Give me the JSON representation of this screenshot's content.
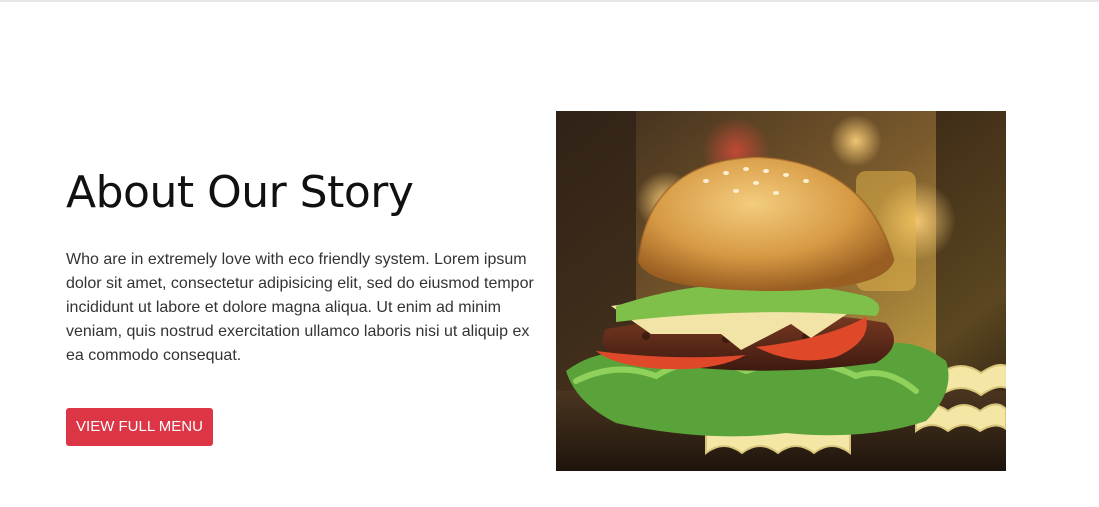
{
  "about": {
    "title": "About Our Story",
    "description": "Who are in extremely love with eco friendly system. Lorem ipsum dolor sit amet, consectetur adipisicing elit, sed do eiusmod tempor incididunt ut labore et dolore magna aliqua. Ut enim ad minim veniam, quis nostrud exercitation ullamco laboris nisi ut aliquip ex ea commodo consequat.",
    "button_label": "VIEW FULL MENU",
    "image_subject": "burger-photo"
  },
  "colors": {
    "accent": "#dc3545",
    "title": "#111111",
    "text": "#333333"
  }
}
